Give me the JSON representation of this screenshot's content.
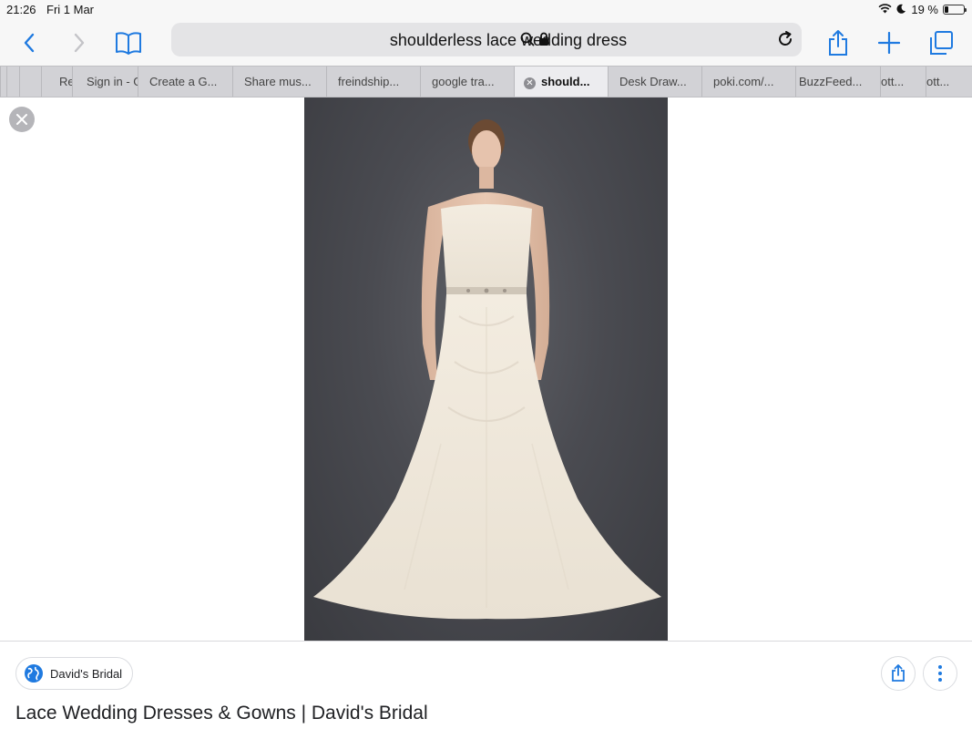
{
  "status_bar": {
    "time": "21:26",
    "date": "Fri 1 Mar",
    "battery_text": "19 %",
    "battery_level": 0.19
  },
  "toolbar": {
    "address_text": "shoulderless lace wedding dress",
    "accent_color": "#1f7ae0"
  },
  "tabs": [
    {
      "label": "Re"
    },
    {
      "label": "Sign in - G"
    },
    {
      "label": "Create a G..."
    },
    {
      "label": "Share mus..."
    },
    {
      "label": "freindship..."
    },
    {
      "label": "google tra..."
    },
    {
      "label": "should...",
      "active": true
    },
    {
      "label": "Desk Draw..."
    },
    {
      "label": "poki.com/..."
    },
    {
      "label": "BuzzFeed..."
    },
    {
      "label": "ott..."
    },
    {
      "label": "ott..."
    }
  ],
  "result": {
    "source_name": "David's Bridal",
    "title": "Lace Wedding Dresses & Gowns | David's Bridal"
  }
}
